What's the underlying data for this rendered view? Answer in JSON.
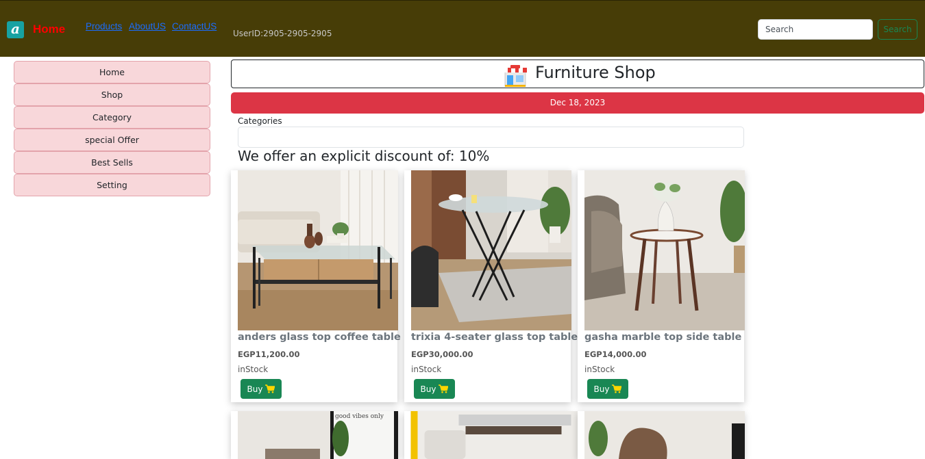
{
  "navbar": {
    "logo_letter": "a",
    "brand": "Home",
    "links": [
      "Products",
      "AboutUS",
      "ContactUS"
    ],
    "user_id": "UserID:2905-2905-2905",
    "search_placeholder": "Search",
    "search_button": "Search",
    "bg_color": "#473d07"
  },
  "sidebar": {
    "items": [
      "Home",
      "Shop",
      "Category",
      "special Offer",
      "Best Sells",
      "Setting"
    ]
  },
  "main": {
    "title_icon": "shop-icon",
    "title": "Furniture Shop",
    "date": "Dec 18, 2023",
    "categories_label": "Categories",
    "categories_value": "",
    "discount_text": "We offer an explicit discount of: 10%"
  },
  "products": [
    {
      "name": "anders glass top coffee table",
      "price": "EGP11,200.00",
      "stock": "inStock",
      "buy": "Buy"
    },
    {
      "name": "trixia 4-seater glass top table",
      "price": "EGP30,000.00",
      "stock": "inStock",
      "buy": "Buy"
    },
    {
      "name": "gasha marble top side table",
      "price": "EGP14,000.00",
      "stock": "inStock",
      "buy": "Buy"
    }
  ],
  "second_row_images": [
    "good vibes only"
  ],
  "colors": {
    "date_bar": "#dc3545",
    "buy_button": "#198754",
    "sidebar_item": "#f8d7da",
    "brand_text": "#ff0000"
  }
}
